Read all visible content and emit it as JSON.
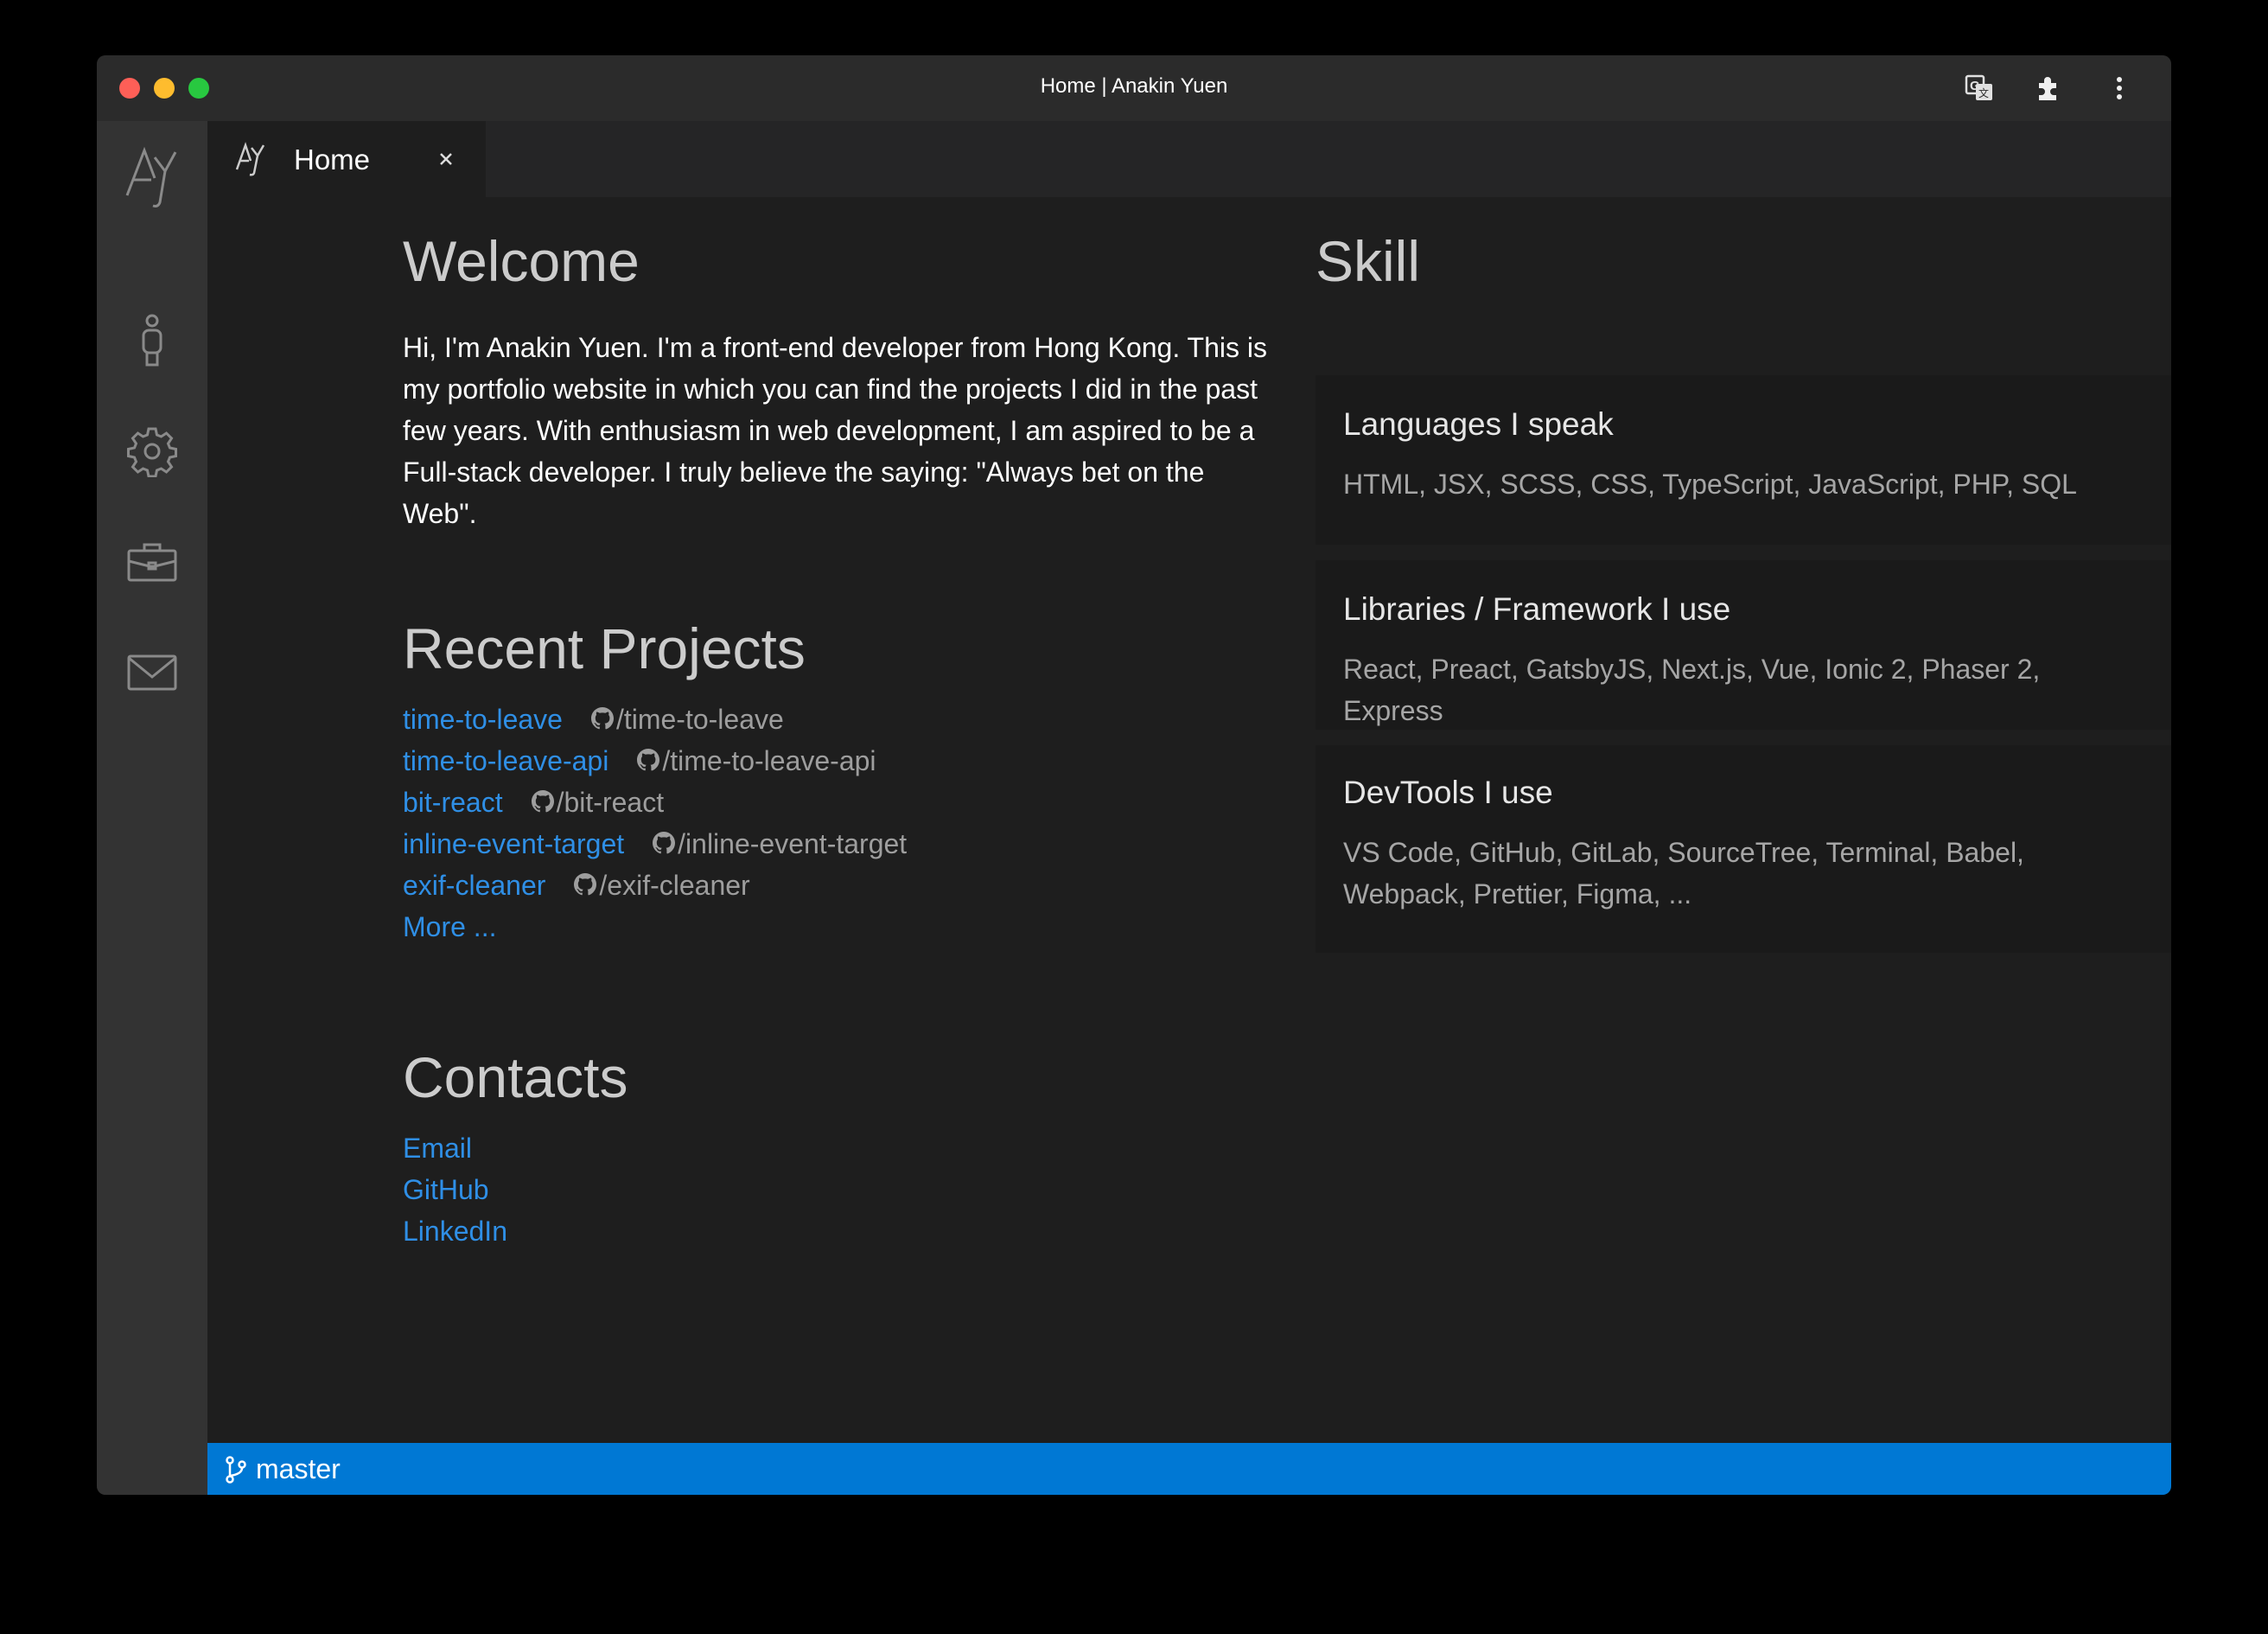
{
  "window": {
    "title": "Home | Anakin Yuen"
  },
  "activity_bar": {
    "items": [
      {
        "icon": "logo-icon"
      },
      {
        "icon": "person-icon"
      },
      {
        "icon": "gear-icon"
      },
      {
        "icon": "briefcase-icon"
      },
      {
        "icon": "mail-icon"
      }
    ]
  },
  "tabs": [
    {
      "label": "Home",
      "icon": "logo-icon",
      "active": true
    }
  ],
  "welcome": {
    "heading": "Welcome",
    "text": "Hi, I'm Anakin Yuen. I'm a front-end developer from Hong Kong. This is my portfolio website in which you can find the projects I did in the past few years. With enthusiasm in web development, I am aspired to be a Full-stack developer. I truly believe the saying: \"Always bet on the Web\"."
  },
  "projects": {
    "heading": "Recent Projects",
    "items": [
      {
        "name": "time-to-leave",
        "repo": "/time-to-leave"
      },
      {
        "name": "time-to-leave-api",
        "repo": "/time-to-leave-api"
      },
      {
        "name": "bit-react",
        "repo": "/bit-react"
      },
      {
        "name": "inline-event-target",
        "repo": "/inline-event-target"
      },
      {
        "name": "exif-cleaner",
        "repo": "/exif-cleaner"
      }
    ],
    "more": "More ..."
  },
  "contacts": {
    "heading": "Contacts",
    "items": [
      "Email",
      "GitHub",
      "LinkedIn"
    ]
  },
  "skill": {
    "heading": "Skill",
    "cards": [
      {
        "title": "Languages I speak",
        "body": "HTML, JSX, SCSS, CSS, TypeScript, JavaScript, PHP, SQL"
      },
      {
        "title": "Libraries / Framework I use",
        "body": "React, Preact, GatsbyJS, Next.js, Vue, Ionic 2, Phaser 2, Express"
      },
      {
        "title": "DevTools I use",
        "body": "VS Code, GitHub, GitLab, SourceTree, Terminal, Babel, Webpack, Prettier, Figma, ..."
      }
    ]
  },
  "status_bar": {
    "branch": "master",
    "color": "#0078d4"
  },
  "colors": {
    "link": "#2f8fe6",
    "background": "#1e1e1e",
    "activity_bar": "#333333"
  }
}
